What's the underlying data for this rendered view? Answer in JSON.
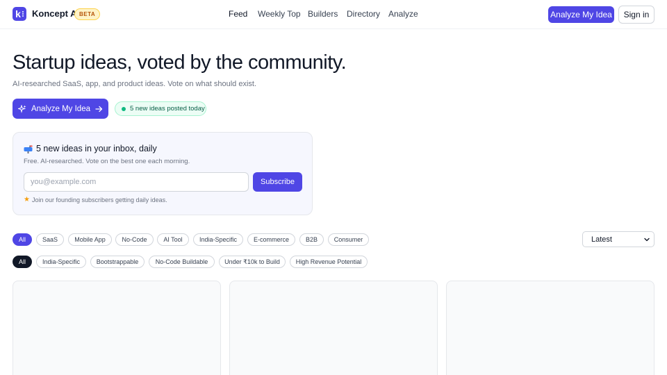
{
  "header": {
    "brand": "Koncept AI",
    "badge": "BETA",
    "nav": [
      "Feed",
      "Weekly Top",
      "Builders",
      "Directory",
      "Analyze"
    ],
    "analyze_button": "Analyze My Idea",
    "signin_button": "Sign in"
  },
  "hero": {
    "title": "Startup ideas, voted by the community.",
    "subtitle": "AI-researched SaaS, app, and product ideas. Vote on what should exist.",
    "cta": "Analyze My Idea",
    "new_ideas": "5 new ideas posted today"
  },
  "newsletter": {
    "title": "5 new ideas in your inbox, daily",
    "subtitle": "Free. AI-researched. Vote on the best one each morning.",
    "email_placeholder": "you@example.com",
    "subscribe": "Subscribe",
    "note": "Join our founding subscribers getting daily ideas."
  },
  "filters": {
    "categories": [
      "All",
      "SaaS",
      "Mobile App",
      "No-Code",
      "AI Tool",
      "India-Specific",
      "E-commerce",
      "B2B",
      "Consumer"
    ],
    "tags": [
      "All",
      "India-Specific",
      "Bootstrappable",
      "No-Code Buildable",
      "Under ₹10k to Build",
      "High Revenue Potential"
    ],
    "sort": "Latest"
  },
  "colors": {
    "accent": "#4f46e5",
    "success": "#10b981",
    "dark_chip": "#111827"
  }
}
